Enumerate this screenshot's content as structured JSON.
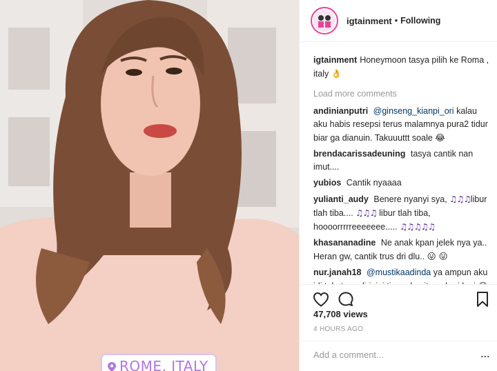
{
  "post": {
    "username": "igtainment",
    "separator": "•",
    "follow_state": "Following",
    "location_sticker": "ROME, ITALY",
    "caption": {
      "username": "igtainment",
      "text": "Honeymoon tasya pilih ke Roma , italy",
      "emoji": "👌"
    },
    "load_more_label": "Load more comments",
    "comments": [
      {
        "username": "andinianputri",
        "mention": "@ginseng_kianpi_ori",
        "text": "kalau aku habis resepsi terus malamnya pura2 tidur biar ga dianuin. Takuuuttt soale",
        "emoji": "😂"
      },
      {
        "username": "brendacarissadeuning",
        "text": "tasya cantik nan imut....",
        "emoji": ""
      },
      {
        "username": "yubios",
        "text": "Cantik nyaaaa",
        "emoji": ""
      },
      {
        "username": "yulianti_audy",
        "text_a": "Benere nyanyi sya,",
        "notes_a": "♫♫♫",
        "text_b": "libur tlah tiba....",
        "notes_b": "♫♫♫",
        "text_c": "libur tlah tiba, hoooorrrrreeeeeee.....",
        "notes_c": "♫♫♫♫♫"
      },
      {
        "username": "khasananadine",
        "text": "Ne anak kpan jelek nya ya.. Heran gw, cantik trus dri dlu..",
        "emoji": "😛 😛"
      },
      {
        "username": "nur.janah18",
        "mention": "@mustikaadinda",
        "text": "ya ampun aku jdi takut sendiri..ini tinggal ngitung hari lagi",
        "emoji": "😂"
      }
    ],
    "views": "47,708 views",
    "timestamp": "4 HOURS AGO",
    "add_comment_placeholder": "Add a comment...",
    "more_label": "..."
  },
  "icons": {
    "like": "heart-icon",
    "comment": "comment-icon",
    "save": "bookmark-icon",
    "location": "location-pin-icon",
    "avatar": "profile-avatar"
  },
  "colors": {
    "accent_pink": "#e6429a",
    "sticker_purple": "#b176e3",
    "muted": "#999999",
    "mention": "#003569"
  }
}
